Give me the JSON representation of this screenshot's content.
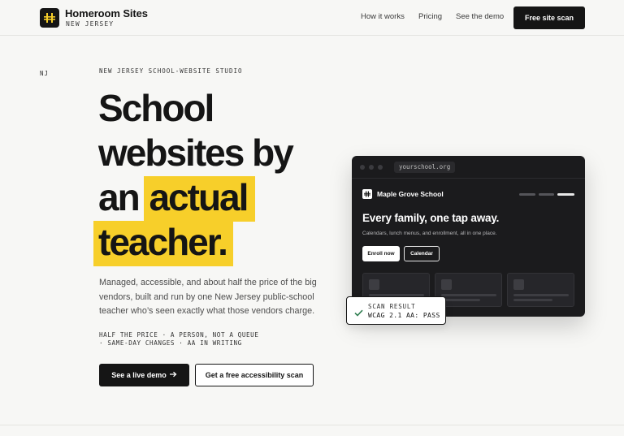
{
  "header": {
    "brand_name": "Homeroom Sites",
    "brand_sub": "NEW JERSEY",
    "nav": [
      {
        "label": "How it works"
      },
      {
        "label": "Pricing"
      },
      {
        "label": "See the demo"
      }
    ],
    "cta_label": "Free site scan"
  },
  "hero": {
    "state_tag": "NJ",
    "eyebrow": "NEW JERSEY SCHOOL-WEBSITE STUDIO",
    "headline": {
      "line1": "School",
      "line2": "websites by",
      "line3_plain": "an",
      "line3_highlight": "actual",
      "line4_highlight": "teacher."
    },
    "lead": "Managed, accessible, and about half the price of the big vendors, built and run by one New Jersey public-school teacher who’s seen exactly what those vendors charge.",
    "features_line1": "HALF THE PRICE · A PERSON, NOT A QUEUE",
    "features_line2": "· SAME-DAY CHANGES · AA IN WRITING",
    "primary_label": "See a live demo",
    "secondary_label": "Get a free accessibility scan"
  },
  "mockup": {
    "url": "yourschool.org",
    "site_name": "Maple Grove School",
    "headline": "Every family, one tap away.",
    "subtext": "Calendars, lunch menus, and enrollment, all in one place.",
    "btn_enroll": "Enroll now",
    "btn_calendar": "Calendar"
  },
  "scan": {
    "label": "SCAN RESULT",
    "value": "WCAG 2.1 AA: PASS"
  },
  "colors": {
    "accent": "#f7cf2a",
    "ink": "#151515",
    "background": "#f7f7f5",
    "mockup_bg": "#1b1b1d",
    "check": "#2e7d4f"
  },
  "icons": {
    "brand": "hash-grid-icon",
    "arrow": "arrow-right-icon",
    "check": "check-icon"
  }
}
